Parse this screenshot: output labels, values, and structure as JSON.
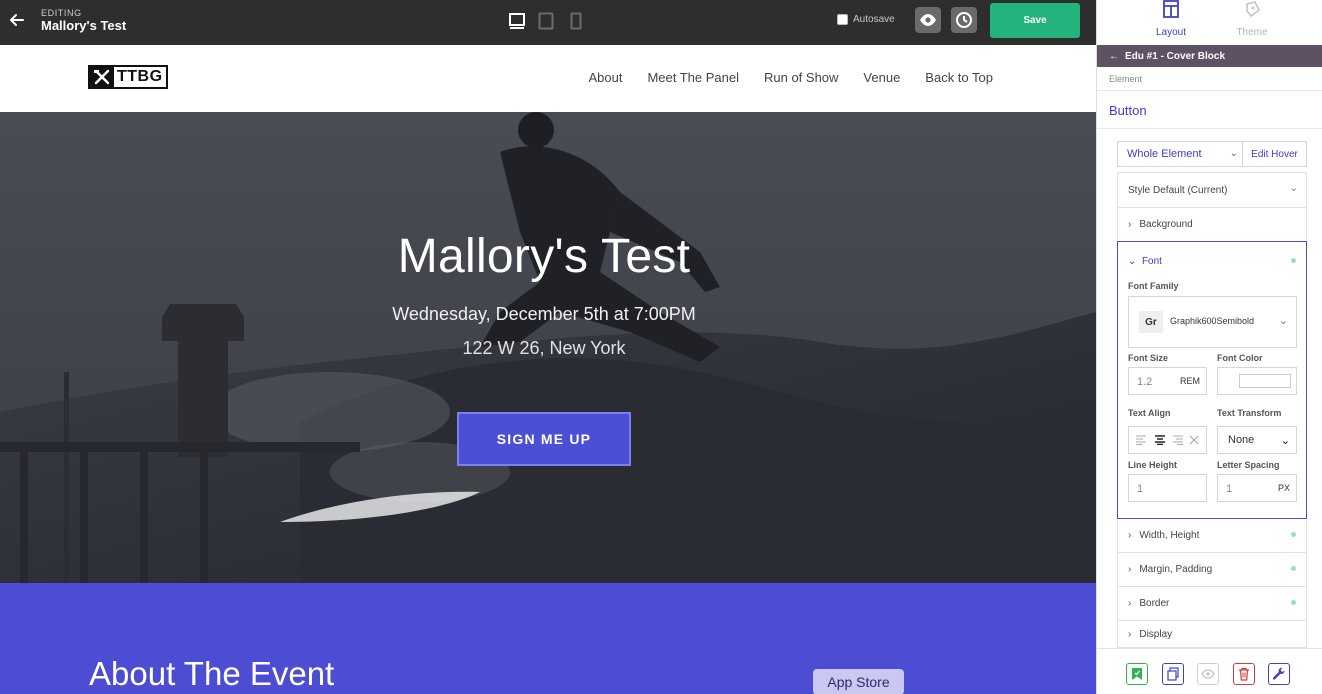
{
  "topbar": {
    "editing_label": "EDITING",
    "page_title": "Mallory's Test",
    "autosave_label": "Autosave",
    "save_label": "Save"
  },
  "site_nav": {
    "logo_text": "TTBG",
    "links": [
      "About",
      "Meet The Panel",
      "Run of Show",
      "Venue",
      "Back to Top"
    ]
  },
  "hero": {
    "title": "Mallory's Test",
    "date": "Wednesday, December 5th at 7:00PM",
    "address": "122 W 26, New York",
    "cta_label": "SIGN ME UP"
  },
  "about": {
    "title": "About The Event",
    "app_store_label": "App Store"
  },
  "panel": {
    "tabs": [
      "Layout",
      "Theme"
    ],
    "breadcrumb": "Edu #1 - Cover Block",
    "element_label": "Element",
    "element_name": "Button",
    "scope_select": "Whole Element",
    "edit_hover_label": "Edit Hover",
    "style_default": "Style Default (Current)",
    "sections_top": [
      "Background"
    ],
    "font": {
      "section_label": "Font",
      "family_label": "Font Family",
      "family_badge": "Gr",
      "family_value": "Graphik600Semibold",
      "size_label": "Font Size",
      "size_value": "1.2",
      "size_unit": "REM",
      "color_label": "Font Color",
      "align_label": "Text Align",
      "transform_label": "Text Transform",
      "transform_value": "None",
      "line_height_label": "Line Height",
      "line_height_value": "1",
      "letter_spacing_label": "Letter Spacing",
      "letter_spacing_value": "1",
      "letter_spacing_unit": "PX"
    },
    "sections_bottom": [
      "Width, Height",
      "Margin, Padding",
      "Border",
      "Display"
    ]
  },
  "colors": {
    "accent": "#4b4fd6",
    "save_green": "#23b47e",
    "about_bg": "#4d4dd4",
    "topbar_bg": "#2e2e2e"
  }
}
